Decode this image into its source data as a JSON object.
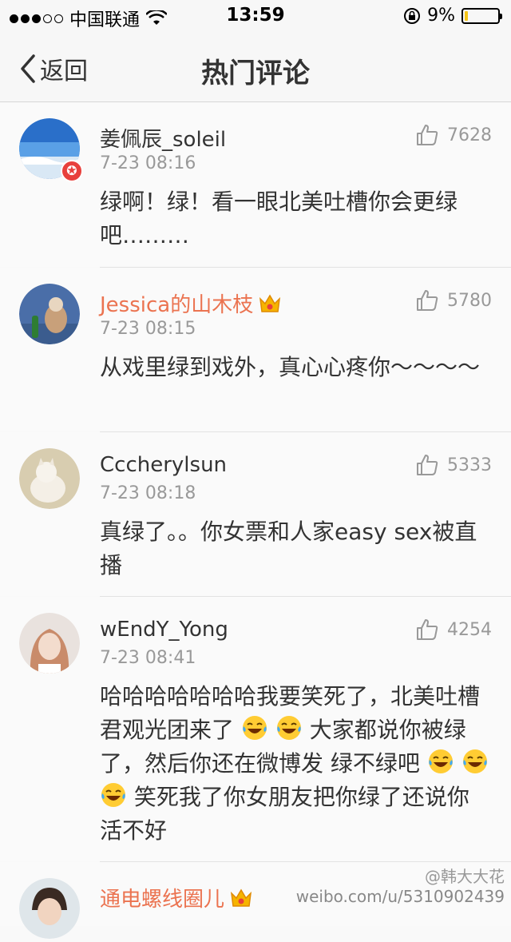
{
  "status": {
    "carrier": "中国联通",
    "time": "13:59",
    "battery_text": "9%",
    "battery_level": 0.09,
    "signal_bars_filled": 3,
    "signal_bars_total": 5
  },
  "nav": {
    "back_label": "返回",
    "title": "热门评论"
  },
  "comments": [
    {
      "name": "姜佩辰_soleil",
      "time": "7-23 08:16",
      "likes": "7628",
      "text": "绿啊！绿！看一眼北美吐槽你会更绿吧………",
      "verified": true,
      "vip": false
    },
    {
      "name": "Jessica的山木枝",
      "time": "7-23 08:15",
      "likes": "5780",
      "text": "从戏里绿到戏外，真心心疼你～～～～",
      "verified": false,
      "vip": true
    },
    {
      "name": "Cccherylsun",
      "time": "7-23 08:18",
      "likes": "5333",
      "text": "真绿了。。你女票和人家easy sex被直播",
      "verified": false,
      "vip": false
    },
    {
      "name": "wEndY_Yong",
      "time": "7-23 08:41",
      "likes": "4254",
      "text_parts": [
        "哈哈哈哈哈哈哈我要笑死了，北美吐槽君观光团来了",
        "大家都说你被绿了，然后你还在微博发 绿不绿吧",
        "笑死我了你女朋友把你绿了还说你活不好"
      ],
      "verified": false,
      "vip": false
    },
    {
      "name": "通电螺线圈儿",
      "verified": false,
      "vip": true
    }
  ],
  "watermark": {
    "site": "weibo.com/u/5310902439",
    "user": "@韩大大花"
  },
  "colors": {
    "vip_name": "#eb7350",
    "verified_badge": "#e8403c",
    "meta_gray": "#999999"
  }
}
